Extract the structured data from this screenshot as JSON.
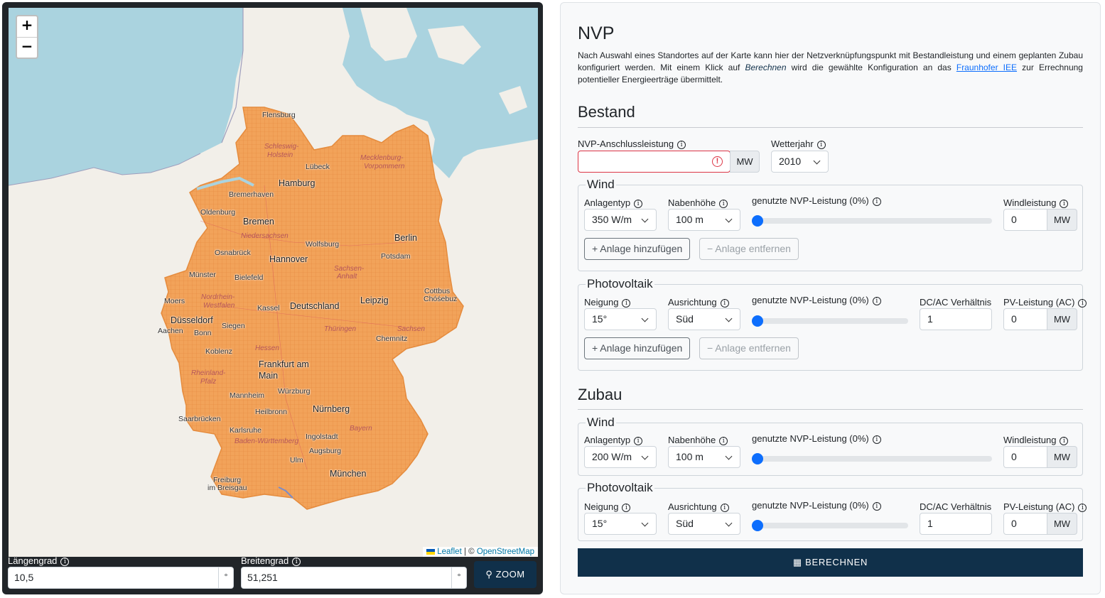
{
  "map": {
    "zoom_in": "+",
    "zoom_out": "−",
    "attribution": {
      "leaflet": "Leaflet",
      "separator": " | © ",
      "osm": "OpenStreetMap"
    },
    "labels": [
      {
        "id": "flensburg",
        "text": "Flensburg"
      },
      {
        "id": "schleswig",
        "text": "Schleswig-"
      },
      {
        "id": "holstein",
        "text": "Holstein"
      },
      {
        "id": "luebeck",
        "text": "Lübeck"
      },
      {
        "id": "mecklenburg",
        "text": "Mecklenburg-"
      },
      {
        "id": "vorpommern",
        "text": "Vorpommern"
      },
      {
        "id": "hamburg",
        "text": "Hamburg"
      },
      {
        "id": "bremerhaven",
        "text": "Bremerhaven"
      },
      {
        "id": "oldenburg",
        "text": "Oldenburg"
      },
      {
        "id": "bremen",
        "text": "Bremen"
      },
      {
        "id": "niedersachsen",
        "text": "Niedersachsen"
      },
      {
        "id": "berlin",
        "text": "Berlin"
      },
      {
        "id": "wolfsburg",
        "text": "Wolfsburg"
      },
      {
        "id": "osnabrueck",
        "text": "Osnabrück"
      },
      {
        "id": "hannover",
        "text": "Hannover"
      },
      {
        "id": "potsdam",
        "text": "Potsdam"
      },
      {
        "id": "sachsen_anhalt1",
        "text": "Sachsen-"
      },
      {
        "id": "sachsen_anhalt2",
        "text": "Anhalt"
      },
      {
        "id": "muenster",
        "text": "Münster"
      },
      {
        "id": "bielefeld",
        "text": "Bielefeld"
      },
      {
        "id": "cottbus",
        "text": "Cottbus"
      },
      {
        "id": "chosebuz",
        "text": "Chóśebuz"
      },
      {
        "id": "moers",
        "text": "Moers"
      },
      {
        "id": "nrw1",
        "text": "Nordrhein-"
      },
      {
        "id": "nrw2",
        "text": "Westfalen"
      },
      {
        "id": "kassel",
        "text": "Kassel"
      },
      {
        "id": "deutschland",
        "text": "Deutschland"
      },
      {
        "id": "leipzig",
        "text": "Leipzig"
      },
      {
        "id": "duesseldorf",
        "text": "Düsseldorf"
      },
      {
        "id": "aachen",
        "text": "Aachen"
      },
      {
        "id": "bonn",
        "text": "Bonn"
      },
      {
        "id": "siegen",
        "text": "Siegen"
      },
      {
        "id": "thueringen",
        "text": "Thüringen"
      },
      {
        "id": "sachsen",
        "text": "Sachsen"
      },
      {
        "id": "chemnitz",
        "text": "Chemnitz"
      },
      {
        "id": "hessen",
        "text": "Hessen"
      },
      {
        "id": "koblenz",
        "text": "Koblenz"
      },
      {
        "id": "frankfurt1",
        "text": "Frankfurt am"
      },
      {
        "id": "frankfurt2",
        "text": "Main"
      },
      {
        "id": "rlp1",
        "text": "Rheinland-"
      },
      {
        "id": "rlp2",
        "text": "Pfalz"
      },
      {
        "id": "mannheim",
        "text": "Mannheim"
      },
      {
        "id": "wuerzburg",
        "text": "Würzburg"
      },
      {
        "id": "nuernberg",
        "text": "Nürnberg"
      },
      {
        "id": "saarbruecken",
        "text": "Saarbrücken"
      },
      {
        "id": "heilbronn",
        "text": "Heilbronn"
      },
      {
        "id": "karlsruhe",
        "text": "Karlsruhe"
      },
      {
        "id": "bayern",
        "text": "Bayern"
      },
      {
        "id": "ingolstadt",
        "text": "Ingolstadt"
      },
      {
        "id": "bw",
        "text": "Baden-Württemberg"
      },
      {
        "id": "augsburg",
        "text": "Augsburg"
      },
      {
        "id": "ulm",
        "text": "Ulm"
      },
      {
        "id": "muenchen",
        "text": "München"
      },
      {
        "id": "freiburg1",
        "text": "Freiburg"
      },
      {
        "id": "freiburg2",
        "text": "im Breisgau"
      }
    ],
    "colors": {
      "sea": "#aad3df",
      "land": "#f2efe9",
      "coverage": "#f2a35a",
      "grid": "#e07b33"
    }
  },
  "coords": {
    "lon_label": "Längengrad",
    "lon_value": "10,5",
    "lat_label": "Breitengrad",
    "lat_value": "51,251",
    "unit": "°",
    "zoom_button": "ZOOM"
  },
  "nvp": {
    "title": "NVP",
    "intro_1": "Nach Auswahl eines Standortes auf der Karte kann hier der Netzverknüpfungspunkt mit Bestandleistung und einem geplanten Zubau konfiguriert werden. Mit einem Klick auf ",
    "intro_em": "Berechnen",
    "intro_2": " wird die gewählte Konfiguration an das ",
    "intro_link": "Fraunhofer IEE",
    "intro_3": " zur Errechnung potentieller Energieerträge übermittelt."
  },
  "bestand": {
    "title": "Bestand",
    "anschluss_label": "NVP-Anschlussleistung",
    "anschluss_value": "",
    "anschluss_unit": "MW",
    "wetterjahr_label": "Wetterjahr",
    "wetterjahr_value": "2010",
    "wind": {
      "legend": "Wind",
      "anlagentyp_label": "Anlagentyp",
      "anlagentyp_value": "350 W/m",
      "nabenhoehe_label": "Nabenhöhe",
      "nabenhoehe_value": "100 m",
      "nvp_label": "genutzte NVP-Leistung (0%)",
      "nvp_fraction": 0,
      "leistung_label": "Windleistung",
      "leistung_value": "0",
      "leistung_unit": "MW",
      "add": "Anlage hinzufügen",
      "remove": "Anlage entfernen"
    },
    "pv": {
      "legend": "Photovoltaik",
      "neigung_label": "Neigung",
      "neigung_value": "15°",
      "ausrichtung_label": "Ausrichtung",
      "ausrichtung_value": "Süd",
      "nvp_label": "genutzte NVP-Leistung (0%)",
      "nvp_fraction": 0,
      "dcac_label": "DC/AC Verhältnis",
      "dcac_value": "1",
      "leistung_label": "PV-Leistung (AC)",
      "leistung_value": "0",
      "leistung_unit": "MW",
      "add": "Anlage hinzufügen",
      "remove": "Anlage entfernen"
    }
  },
  "zubau": {
    "title": "Zubau",
    "wind": {
      "legend": "Wind",
      "anlagentyp_label": "Anlagentyp",
      "anlagentyp_value": "200 W/m",
      "nabenhoehe_label": "Nabenhöhe",
      "nabenhoehe_value": "100 m",
      "nvp_label": "genutzte NVP-Leistung (0%)",
      "nvp_fraction": 0,
      "leistung_label": "Windleistung",
      "leistung_value": "0",
      "leistung_unit": "MW"
    },
    "pv": {
      "legend": "Photovoltaik",
      "neigung_label": "Neigung",
      "neigung_value": "15°",
      "ausrichtung_label": "Ausrichtung",
      "ausrichtung_value": "Süd",
      "nvp_label": "genutzte NVP-Leistung (0%)",
      "nvp_fraction": 0,
      "dcac_label": "DC/AC Verhältnis",
      "dcac_value": "1",
      "leistung_label": "PV-Leistung (AC)",
      "leistung_value": "0",
      "leistung_unit": "MW"
    }
  },
  "actions": {
    "berechnen": "BERECHNEN"
  }
}
